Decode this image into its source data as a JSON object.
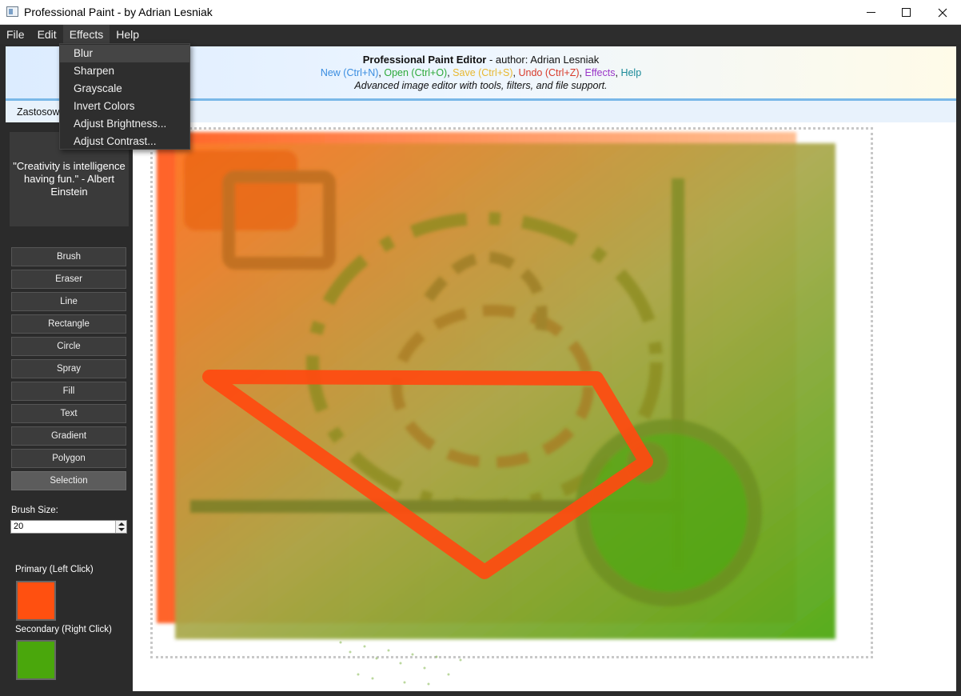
{
  "window": {
    "title": "Professional Paint - by Adrian Lesniak"
  },
  "menubar": {
    "items": [
      "File",
      "Edit",
      "Effects",
      "Help"
    ],
    "active": "Effects"
  },
  "effects_menu": {
    "items": [
      "Blur",
      "Sharpen",
      "Grayscale",
      "Invert Colors",
      "Adjust Brightness...",
      "Adjust Contrast..."
    ],
    "hovered": "Blur"
  },
  "header": {
    "title": "Professional Paint Editor",
    "author": " - author: Adrian Lesniak",
    "shortcuts": [
      {
        "text": "New (Ctrl+N)",
        "color": "#3a8de0"
      },
      {
        "text": "Open (Ctrl+O)",
        "color": "#2eaa3a"
      },
      {
        "text": "Save (Ctrl+S)",
        "color": "#e8b830"
      },
      {
        "text": "Undo (Ctrl+Z)",
        "color": "#d83a2a"
      },
      {
        "text": "Effects",
        "color": "#9a36c8"
      },
      {
        "text": "Help",
        "color": "#1a8a98"
      }
    ],
    "separator": ", ",
    "description": "Advanced image editor with tools, filters, and file support."
  },
  "subbar": {
    "label": "Zastosow"
  },
  "sidebar": {
    "quote": "\"Creativity is intelligence having fun.\" - Albert Einstein",
    "tools": [
      "Brush",
      "Eraser",
      "Line",
      "Rectangle",
      "Circle",
      "Spray",
      "Fill",
      "Text",
      "Gradient",
      "Polygon",
      "Selection"
    ],
    "selected_tool": "Selection",
    "brush_size_label": "Brush Size:",
    "brush_size_value": "20",
    "primary_label": "Primary (Left Click)",
    "primary_color": "#ff5010",
    "secondary_label": "Secondary (Right Click)",
    "secondary_color": "#4aa70c"
  }
}
